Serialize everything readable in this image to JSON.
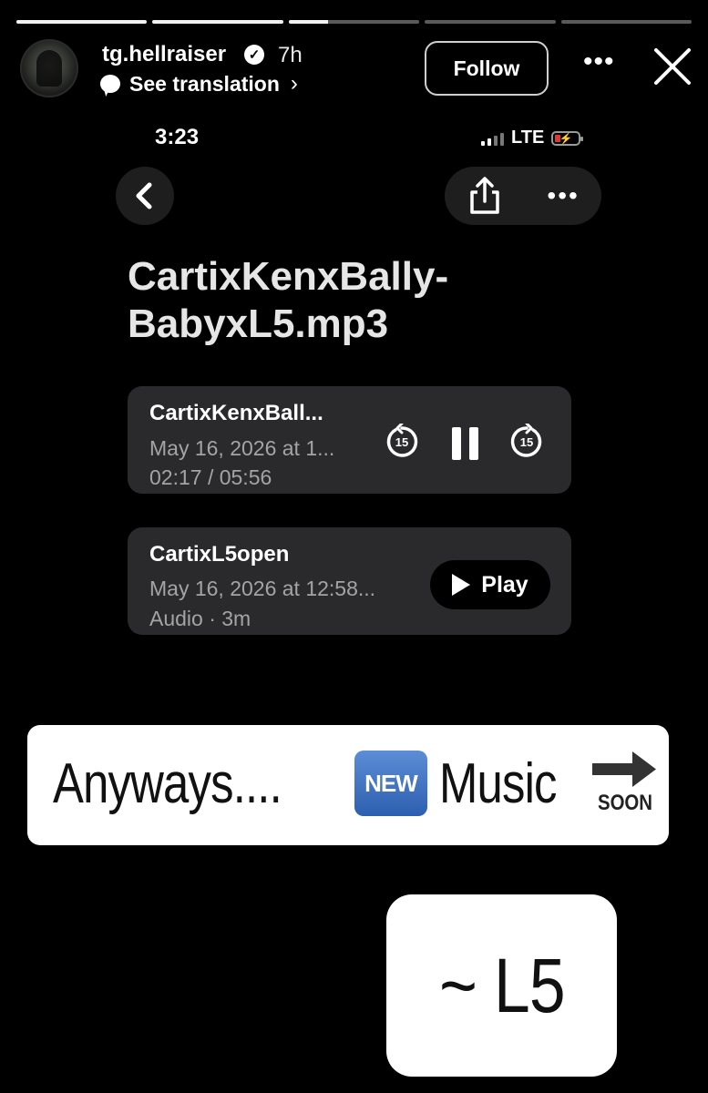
{
  "story": {
    "progress": [
      1,
      1,
      0.3,
      0,
      0
    ]
  },
  "header": {
    "username": "tg.hellraiser",
    "time_ago": "7h",
    "see_translation": "See translation",
    "follow_label": "Follow"
  },
  "phone_status": {
    "time": "3:23",
    "network": "LTE"
  },
  "file": {
    "title": "CartixKenxBally-BabyxL5.mp3"
  },
  "now_playing": {
    "name": "CartixKenxBall...",
    "date": "May 16, 2026 at 1...",
    "progress": "02:17 / 05:56",
    "skip_back_seconds": "15",
    "skip_forward_seconds": "15"
  },
  "second_track": {
    "name": "CartixL5open",
    "date": "May 16, 2026 at 12:58...",
    "meta": "Audio · 3m",
    "play_label": "Play"
  },
  "stickers": {
    "anyways": "Anyways....",
    "new_emoji": "NEW",
    "music": "Music",
    "soon_emoji": "SOON",
    "signature": "~ L5"
  },
  "colors": {
    "background": "#000000",
    "card": "#2a2a2c",
    "subtext": "#a4a4a8",
    "battery_low": "#e03a2e"
  }
}
